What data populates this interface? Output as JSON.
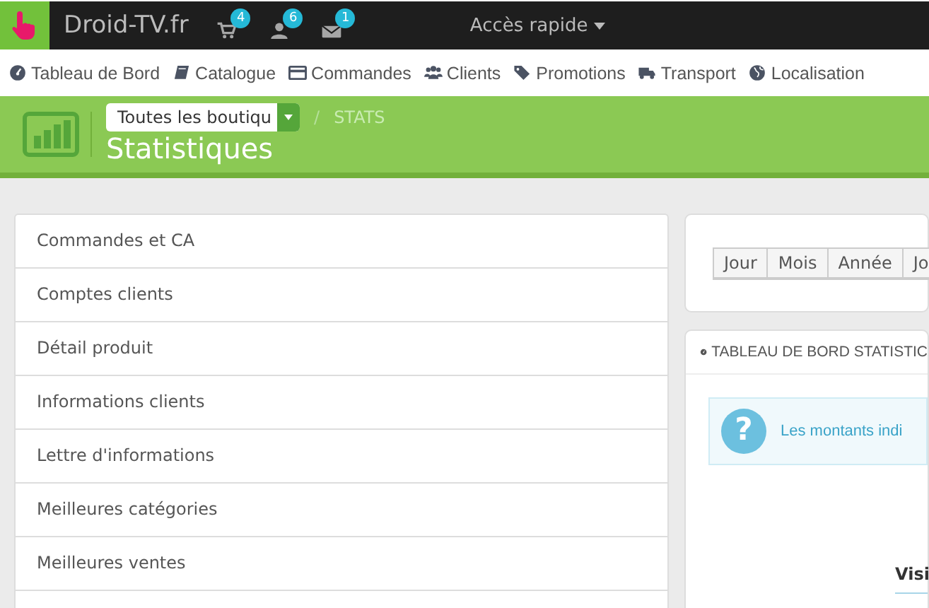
{
  "topbar": {
    "brand": "Droid-TV.fr",
    "badges": [
      {
        "kind": "cart",
        "count": "4"
      },
      {
        "kind": "user",
        "count": "6"
      },
      {
        "kind": "mail",
        "count": "1"
      }
    ],
    "quick_access": "Accès rapide"
  },
  "nav": [
    {
      "kind": "dashboard",
      "label": "Tableau de Bord"
    },
    {
      "kind": "book",
      "label": "Catalogue"
    },
    {
      "kind": "card",
      "label": "Commandes"
    },
    {
      "kind": "users",
      "label": "Clients"
    },
    {
      "kind": "tag",
      "label": "Promotions"
    },
    {
      "kind": "truck",
      "label": "Transport"
    },
    {
      "kind": "globe",
      "label": "Localisation"
    }
  ],
  "header": {
    "shop_select": "Toutes les boutiqu",
    "separator": "/",
    "breadcrumb": "STATS",
    "title": "Statistiques"
  },
  "modules": [
    {
      "label": "Commandes et CA"
    },
    {
      "label": "Comptes clients"
    },
    {
      "label": "Détail produit"
    },
    {
      "label": "Informations clients"
    },
    {
      "label": "Lettre d'informations"
    },
    {
      "label": "Meilleures catégories"
    },
    {
      "label": "Meilleures ventes"
    }
  ],
  "period_buttons": [
    "Jour",
    "Mois",
    "Année",
    "Jo"
  ],
  "dashboard": {
    "title": "TABLEAU DE BORD STATISTIC",
    "info_icon": "?",
    "info": "Les montants indi",
    "column_heading": "Visi"
  }
}
